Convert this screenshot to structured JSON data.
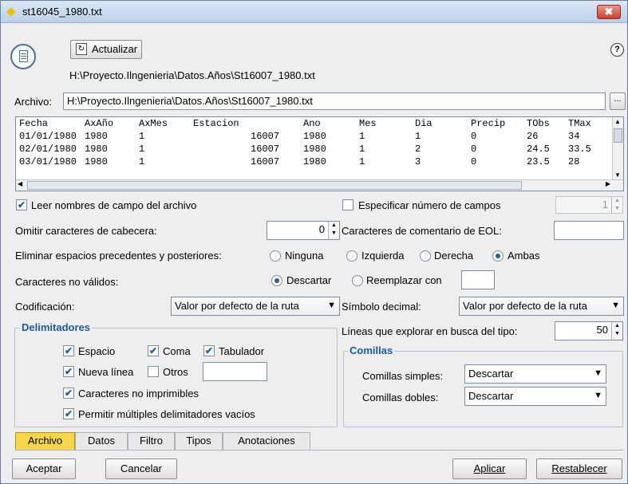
{
  "window": {
    "title": "st16045_1980.txt",
    "close_label": "✖"
  },
  "toolbar": {
    "refresh_label": "Actualizar",
    "help_label": "?"
  },
  "header": {
    "path": "H:\\Proyecto.Ilngenieria\\Datos.Años\\St16007_1980.txt"
  },
  "file": {
    "label": "Archivo:",
    "value": "H:\\Proyecto.Ilngenieria\\Datos.Años\\St16007_1980.txt",
    "browse_label": "..."
  },
  "preview": {
    "columns": [
      "Fecha",
      "AxAño",
      "AxMes",
      "Estacion",
      "",
      "Ano",
      "Mes",
      "Dia",
      "Precip",
      "TObs",
      "TMax"
    ],
    "rows": [
      [
        "01/01/1980",
        "1980",
        "1",
        "",
        "16007",
        "1980",
        "1",
        "1",
        "0",
        "26",
        "34"
      ],
      [
        "02/01/1980",
        "1980",
        "1",
        "",
        "16007",
        "1980",
        "1",
        "2",
        "0",
        "24.5",
        "33.5"
      ],
      [
        "03/01/1980",
        "1980",
        "1",
        "",
        "16007",
        "1980",
        "1",
        "3",
        "0",
        "23.5",
        "28"
      ]
    ]
  },
  "options": {
    "read_field_names": {
      "label": "Leer nombres de campo del archivo",
      "checked": true
    },
    "specify_fields": {
      "label": "Especificar número de campos",
      "checked": false,
      "value": "1"
    },
    "skip_header": {
      "label": "Omitir caracteres de cabecera:",
      "value": "0"
    },
    "eol_comment": {
      "label": "Caracteres de comentario de EOL:",
      "value": ""
    },
    "trim": {
      "label": "Eliminar espacios precedentes y posteriores:",
      "choices": [
        "Ninguna",
        "Izquierda",
        "Derecha",
        "Ambas"
      ],
      "selected": "Ambas"
    },
    "invalid_chars": {
      "label": "Caracteres no válidos:",
      "choices": [
        "Descartar",
        "Reemplazar con"
      ],
      "selected": "Descartar",
      "replace_value": ""
    },
    "encoding": {
      "label": "Codificación:",
      "value": "Valor por defecto de la ruta"
    },
    "decimal": {
      "label": "Símbolo decimal:",
      "value": "Valor por defecto de la ruta"
    },
    "scan_lines": {
      "label": "Líneas que explorar en busca del tipo:",
      "value": "50"
    }
  },
  "delimiters": {
    "title": "Delimitadores",
    "space": {
      "label": "Espacio",
      "checked": true
    },
    "comma": {
      "label": "Coma",
      "checked": true
    },
    "tab": {
      "label": "Tabulador",
      "checked": true
    },
    "newline": {
      "label": "Nueva línea",
      "checked": true
    },
    "others": {
      "label": "Otros",
      "checked": false,
      "value": ""
    },
    "nonprintable": {
      "label": "Caracteres no imprimibles",
      "checked": true
    },
    "multiple_empty": {
      "label": "Permitir múltiples delimitadores vacíos",
      "checked": true
    }
  },
  "quotes": {
    "title": "Comillas",
    "single": {
      "label": "Comillas simples:",
      "value": "Descartar"
    },
    "double": {
      "label": "Comillas dobles:",
      "value": "Descartar"
    }
  },
  "tabs": [
    "Archivo",
    "Datos",
    "Filtro",
    "Tipos",
    "Anotaciones"
  ],
  "buttons": {
    "ok": "Aceptar",
    "cancel": "Cancelar",
    "apply": "Aplicar",
    "reset": "Restablecer"
  },
  "icons": {
    "title": "diamond-icon",
    "file": "file-icon",
    "refresh": "refresh-icon",
    "help": "help-icon",
    "check": "✔",
    "dropdown": "▼",
    "spin_up": "▲",
    "spin_down": "▼"
  },
  "colors": {
    "active_tab": "#f7d64c",
    "group_title": "#1a5aa8",
    "close_button": "#c8422d"
  }
}
